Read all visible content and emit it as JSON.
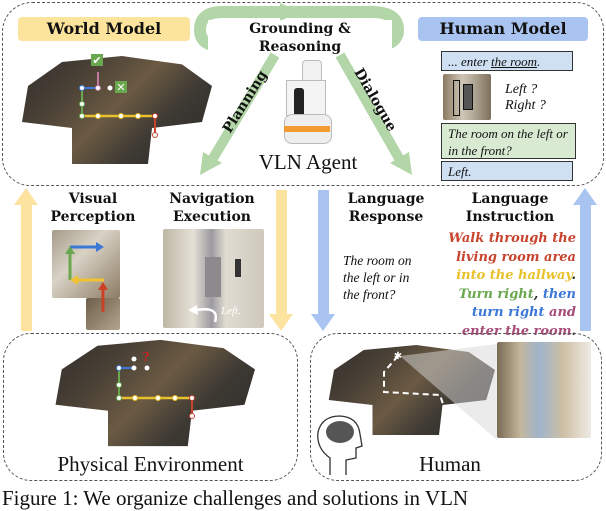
{
  "top_panel": {
    "world_model_label": "World Model",
    "grounding_label": "Grounding & Reasoning",
    "human_model_label": "Human Model",
    "planning_label": "Planning",
    "dialogue_label": "Dialogue",
    "agent_label": "VLN Agent",
    "bubbles": {
      "enter_prefix": "... enter ",
      "enter_underlined": "the room",
      "enter_suffix": ".",
      "left_q": "Left ?",
      "right_q": "Right ?",
      "room_question": "The room on the left or in the front?",
      "answer": "Left."
    }
  },
  "middle": {
    "visual_perception_label": "Visual Perception",
    "navigation_execution_label": "Navigation Execution",
    "nav_overlay_text": "Left.",
    "language_response_label": "Language Response",
    "language_response_text": "The room on the left or in the front?",
    "language_instruction_label": "Language Instruction",
    "instruction_parts": [
      {
        "text": "Walk through the living room area ",
        "color": "#c8442e"
      },
      {
        "text": "into the hallway",
        "color": "#e9c12c"
      },
      {
        "text": ". ",
        "color": "#222222"
      },
      {
        "text": "Turn right",
        "color": "#6aa84f"
      },
      {
        "text": ", ",
        "color": "#222222"
      },
      {
        "text": "then turn right",
        "color": "#3c78d8"
      },
      {
        "text": " and enter the room",
        "color": "#a64d79"
      },
      {
        "text": ".",
        "color": "#222222"
      }
    ]
  },
  "bottom": {
    "physical_environment_label": "Physical Environment",
    "human_label": "Human"
  },
  "caption": "Figure 1: We organize challenges and solutions in VLN",
  "colors": {
    "world_tag": "#fde49c",
    "human_tag": "#a9c4f0",
    "green_arrow": "#b3d6a8",
    "yellow_arrow": "#fde3a0",
    "blue_arrow": "#a9c4f0",
    "blue_bubble": "#cfe0f3",
    "green_bubble": "#d9ead3"
  }
}
